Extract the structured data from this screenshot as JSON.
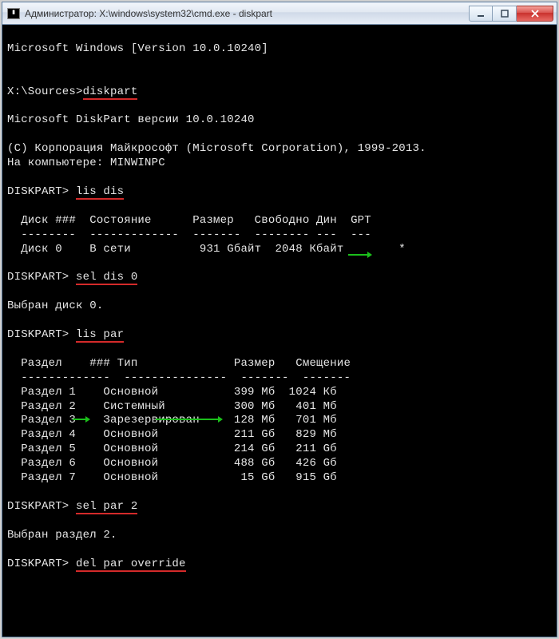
{
  "titlebar": {
    "icon_glyph": "C:\\",
    "text": "Администратор: X:\\windows\\system32\\cmd.exe - diskpart"
  },
  "win_buttons": {
    "minimize": "minimize",
    "maximize": "maximize",
    "close": "close"
  },
  "lines": {
    "ms_windows": "Microsoft Windows [Version 10.0.10240]",
    "prompt1_left": "X:\\Sources>",
    "cmd_diskpart": "diskpart",
    "diskpart_ver": "Microsoft DiskPart версии 10.0.10240",
    "copyright": "(C) Корпорация Майкрософт (Microsoft Corporation), 1999-2013.",
    "on_computer": "На компьютере: MINWINPC",
    "dp_prompt": "DISKPART> ",
    "cmd_lis_dis": "lis dis",
    "disk_header": "  Диск ###  Состояние      Размер   Свободно Дин  GPT",
    "disk_rule": "  --------  -------------  -------  -------- ---  ---",
    "disk_row": "  Диск 0    В сети          931 Gбайт  2048 Кбайт        *",
    "cmd_sel_dis": "sel dis 0",
    "selected_disk": "Выбран диск 0.",
    "cmd_lis_par": "lis par",
    "part_header": "  Раздел    ### Тип              Размер   Смещение",
    "part_rule": "  -------------  ---------------  -------  -------",
    "part_rows": [
      "  Раздел 1    Основной           399 Мб  1024 Кб",
      "  Раздел 2    Системный          300 Мб   401 Мб",
      "  Раздел 3    Зарезервирован     128 Мб   701 Мб",
      "  Раздел 4    Основной           211 Gб   829 Мб",
      "  Раздел 5    Основной           214 Gб   211 Gб",
      "  Раздел 6    Основной           488 Gб   426 Gб",
      "  Раздел 7    Основной            15 Gб   915 Gб"
    ],
    "cmd_sel_par": "sel par 2",
    "selected_part": "Выбран раздел 2.",
    "cmd_del_par": "del par override"
  },
  "annotations": {
    "underline_color": "#d42a2a",
    "arrow_color": "#1bbf1b"
  }
}
